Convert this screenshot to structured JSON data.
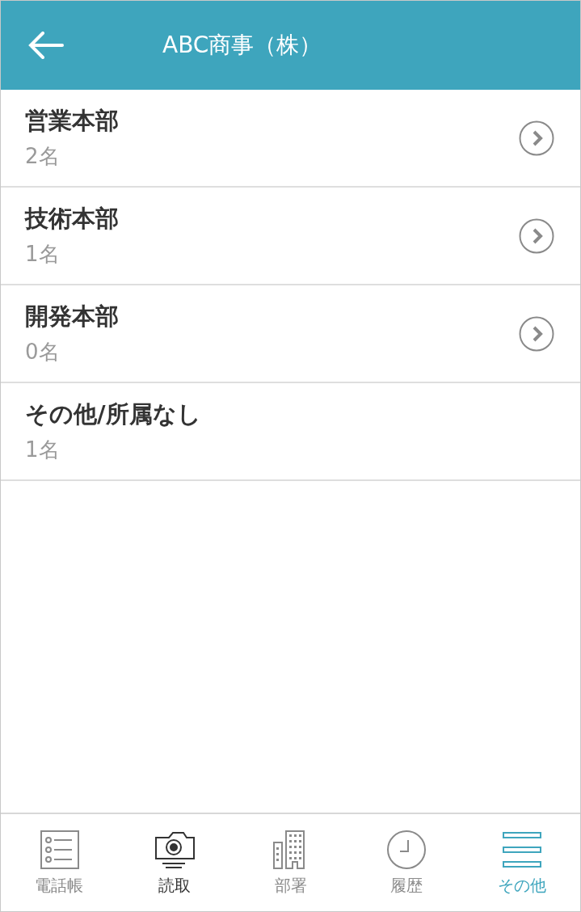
{
  "header": {
    "title": "ABC商事（株）"
  },
  "departments": [
    {
      "name": "営業本部",
      "count": "2名",
      "has_arrow": true
    },
    {
      "name": "技術本部",
      "count": "1名",
      "has_arrow": true
    },
    {
      "name": "開発本部",
      "count": "0名",
      "has_arrow": true
    },
    {
      "name": "その他/所属なし",
      "count": "1名",
      "has_arrow": false
    }
  ],
  "tab_bar": [
    {
      "kind": "phonebook",
      "label": "電話帳",
      "selected": false,
      "emphasized": false
    },
    {
      "kind": "camera",
      "label": "読取",
      "selected": false,
      "emphasized": true
    },
    {
      "kind": "building",
      "label": "部署",
      "selected": false,
      "emphasized": false
    },
    {
      "kind": "clock",
      "label": "履歴",
      "selected": false,
      "emphasized": false
    },
    {
      "kind": "menu",
      "label": "その他",
      "selected": true,
      "emphasized": false
    }
  ]
}
